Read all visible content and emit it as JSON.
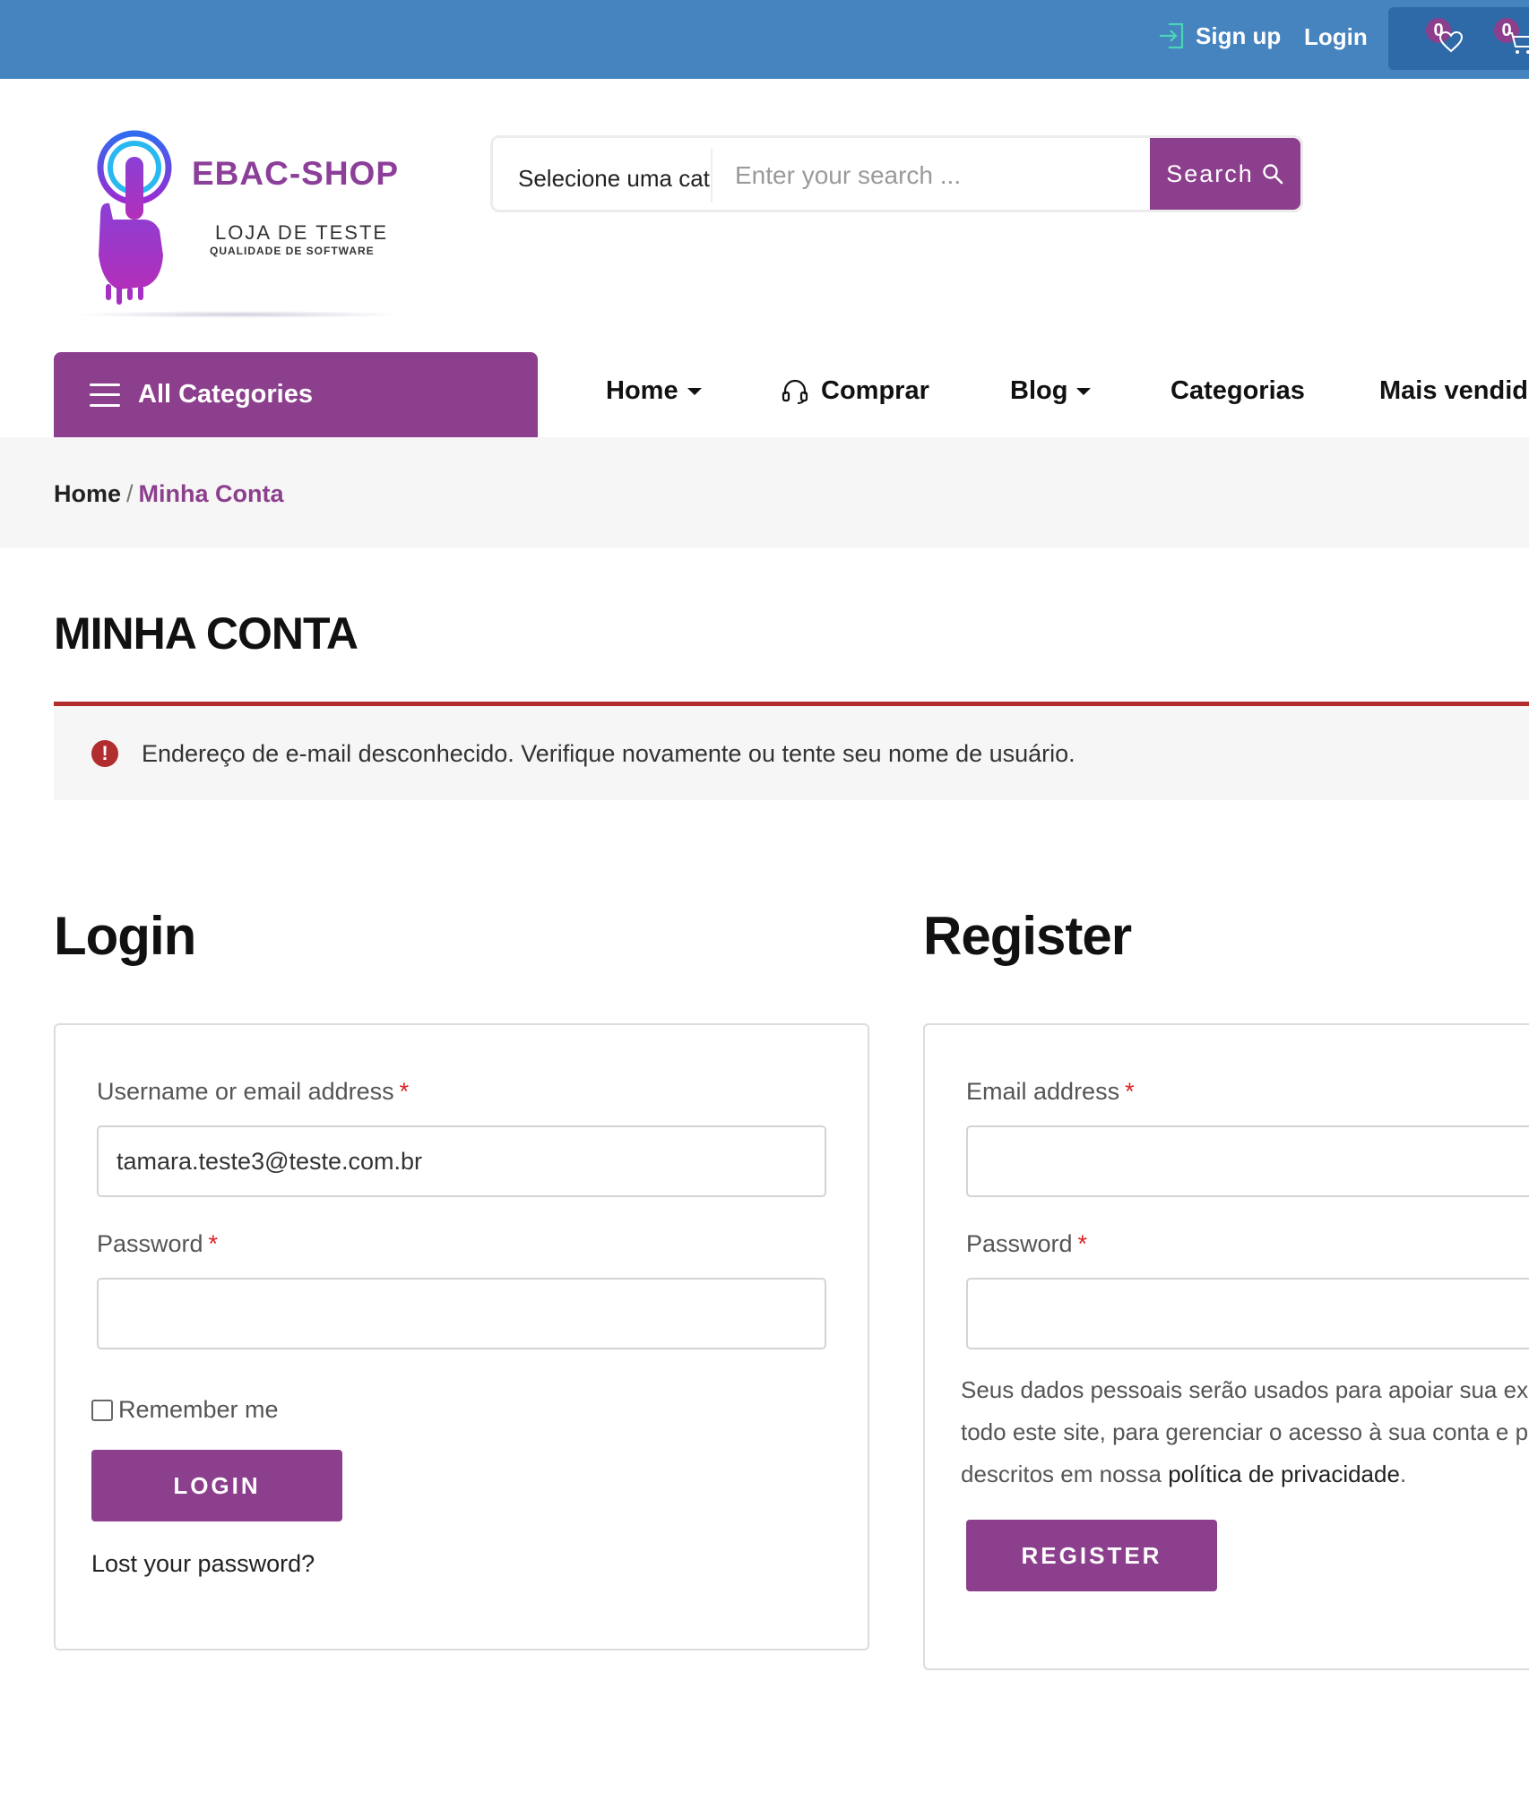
{
  "colors": {
    "topbar": "#4584bf",
    "accent": "#8c3f8c",
    "error": "#b22d2d",
    "band": "#f6f6f6"
  },
  "topbar": {
    "signup_label": "Sign up",
    "login_label": "Login",
    "wishlist_count": "0",
    "cart_count": "0",
    "signup_icon": "signup-icon",
    "wishlist_icon": "heart-icon",
    "cart_icon": "cart-icon"
  },
  "header": {
    "logo_brand": "EBAC-SHOP",
    "logo_tagline": "LOJA DE TESTE",
    "logo_subtagline": "QUALIDADE DE SOFTWARE",
    "search": {
      "category_label": "Selecione uma cat",
      "placeholder": "Enter your search ...",
      "button_label": "Search"
    }
  },
  "nav": {
    "all_categories": "All Categories",
    "items": [
      {
        "label": "Home"
      },
      {
        "label": "Comprar"
      },
      {
        "label": "Blog"
      },
      {
        "label": "Categorias"
      },
      {
        "label": "Mais vendido"
      }
    ]
  },
  "breadcrumb": {
    "home": "Home",
    "separator": "/",
    "current": "Minha Conta"
  },
  "page_title": "MINHA CONTA",
  "notice": {
    "icon": "!",
    "message": "Endereço de e-mail desconhecido. Verifique novamente ou tente seu nome de usuário."
  },
  "login": {
    "heading": "Login",
    "username_label": "Username or email address",
    "username_value": "tamara.teste3@teste.com.br",
    "password_label": "Password",
    "required_mark": "*",
    "remember_label": "Remember me",
    "button_label": "LOGIN",
    "lost_password": "Lost your password?"
  },
  "register": {
    "heading": "Register",
    "email_label": "Email address",
    "password_label": "Password",
    "required_mark": "*",
    "privacy_line1": "Seus dados pessoais serão usados para apoiar sua ex",
    "privacy_line2": "todo este site, para gerenciar o acesso à sua conta e p",
    "privacy_line3_prefix": "descritos em nossa ",
    "privacy_link": "política de privacidade",
    "privacy_line3_suffix": ".",
    "button_label": "REGISTER"
  }
}
